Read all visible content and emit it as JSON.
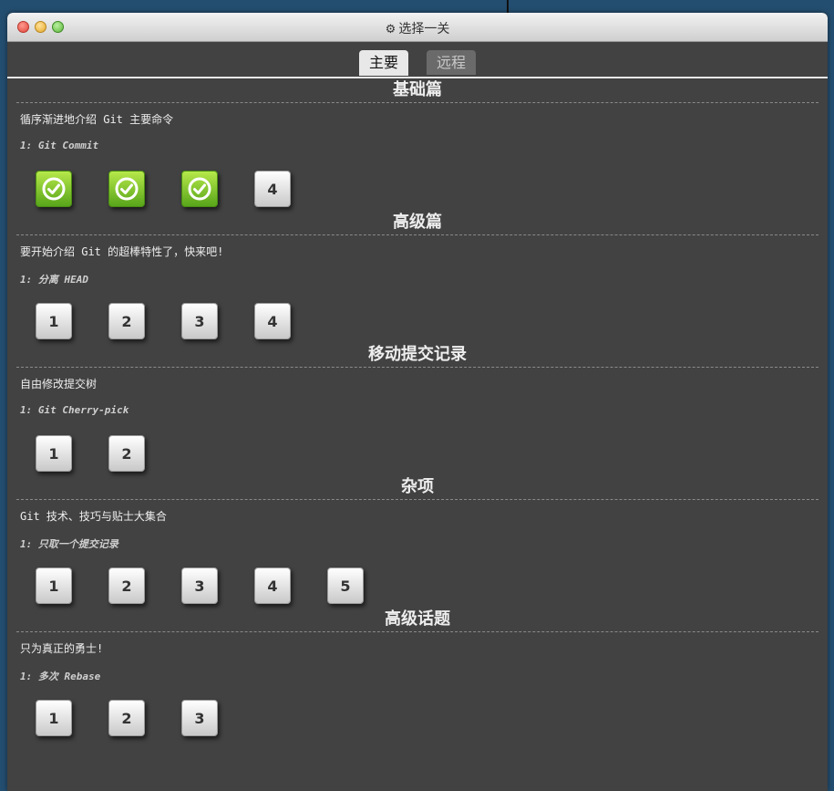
{
  "window": {
    "title": "选择一关",
    "title_icon": "gear-icon"
  },
  "tabs": [
    {
      "label": "主要",
      "active": true
    },
    {
      "label": "远程",
      "active": false
    }
  ],
  "sections": [
    {
      "title": "基础篇",
      "desc": "循序渐进地介绍 Git 主要命令",
      "level": "1: Git Commit",
      "levels": [
        {
          "label": "",
          "done": true,
          "icon": "check-circle-icon"
        },
        {
          "label": "",
          "done": true,
          "icon": "check-circle-icon"
        },
        {
          "label": "",
          "done": true,
          "icon": "check-circle-icon"
        },
        {
          "label": "4",
          "done": false
        }
      ]
    },
    {
      "title": "高级篇",
      "desc": "要开始介绍 Git 的超棒特性了，快来吧!",
      "level": "1: 分离 HEAD",
      "levels": [
        {
          "label": "1",
          "done": false
        },
        {
          "label": "2",
          "done": false
        },
        {
          "label": "3",
          "done": false
        },
        {
          "label": "4",
          "done": false
        }
      ]
    },
    {
      "title": "移动提交记录",
      "desc": "自由修改提交树",
      "level": "1: Git Cherry-pick",
      "levels": [
        {
          "label": "1",
          "done": false
        },
        {
          "label": "2",
          "done": false
        }
      ]
    },
    {
      "title": "杂项",
      "desc": "Git 技术、技巧与贴士大集合",
      "level": "1: 只取一个提交记录",
      "levels": [
        {
          "label": "1",
          "done": false
        },
        {
          "label": "2",
          "done": false
        },
        {
          "label": "3",
          "done": false
        },
        {
          "label": "4",
          "done": false
        },
        {
          "label": "5",
          "done": false
        }
      ]
    },
    {
      "title": "高级话题",
      "desc": "只为真正的勇士!",
      "level": "1: 多次 Rebase",
      "levels": [
        {
          "label": "1",
          "done": false
        },
        {
          "label": "2",
          "done": false
        },
        {
          "label": "3",
          "done": false
        }
      ]
    }
  ],
  "colors": {
    "background": "#424242",
    "done_button": "#58a51a",
    "todo_button": "#e8e8e8"
  }
}
